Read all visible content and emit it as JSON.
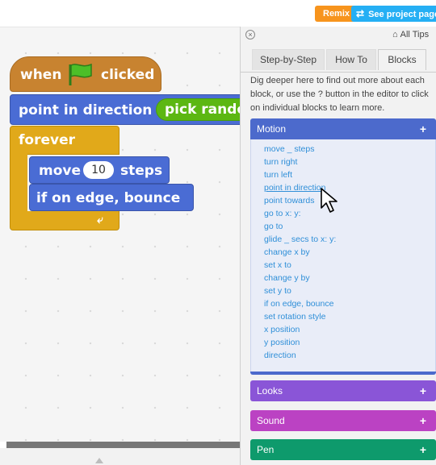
{
  "header": {
    "remix_label": "Remix",
    "project_label": "See project page"
  },
  "script": {
    "hat_when": "when",
    "hat_clicked": "clicked",
    "point_label": "point in direction",
    "operator_label": "pick random",
    "forever_label": "forever",
    "move_label": "move",
    "move_value": "10",
    "steps_label": "steps",
    "bounce_label": "if on edge, bounce"
  },
  "tips": {
    "all_tips_label": "All Tips",
    "tabs": [
      "Step-by-Step",
      "How To",
      "Blocks"
    ],
    "active_tab": "Blocks",
    "intro": "Dig deeper here to find out more about each block, or use the ? button in the editor to click on individual blocks to learn more.",
    "categories": {
      "motion": "Motion",
      "looks": "Looks",
      "sound": "Sound",
      "pen": "Pen"
    },
    "motion_items": [
      "move _ steps",
      "turn right",
      "turn left",
      "point in direction",
      "point towards",
      "go to x: y:",
      "go to",
      "glide _ secs to x: y:",
      "change x by",
      "set x to",
      "change y by",
      "set y to",
      "if on edge, bounce",
      "set rotation style",
      "x position",
      "y position",
      "direction"
    ]
  },
  "colors": {
    "motion": "#4c6acc",
    "looks": "#8a55d7",
    "sound": "#bb42c3",
    "pen": "#0e9a6c",
    "events": "#c88330",
    "control": "#e1a91a",
    "operators": "#5cb712"
  },
  "icons": [
    "green-flag-icon",
    "share-icon",
    "home-icon",
    "close-icon",
    "plus-icon",
    "loop-arrow-icon",
    "mouse-cursor-icon"
  ]
}
